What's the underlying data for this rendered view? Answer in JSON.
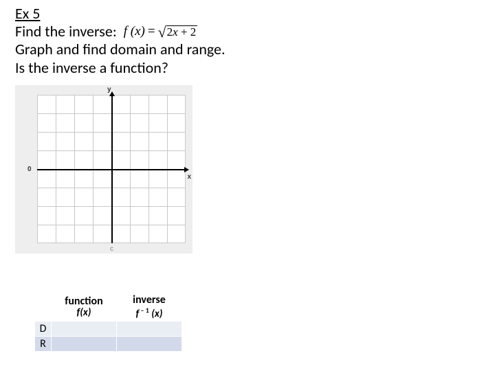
{
  "title": "Ex 5",
  "prompt": {
    "line1_prefix": "Find the inverse:",
    "formula": {
      "lhs": "f (x)",
      "eq": "=",
      "under_sqrt": "2x + 2"
    },
    "line2": "Graph and find domain and range.",
    "line3": "Is the inverse a function?"
  },
  "graph": {
    "y_label": "y",
    "x_label": "x",
    "zero_label": "0",
    "footer_char": "c"
  },
  "table": {
    "headers": {
      "col1_top": "function",
      "col1_sub": "f(x)",
      "col2_top": "inverse",
      "col2_sub_prefix": "f",
      "col2_sub_sup": " – 1",
      "col2_sub_suffix": " (x)"
    },
    "rows": [
      {
        "label": "D",
        "c1": "",
        "c2": ""
      },
      {
        "label": "R",
        "c1": "",
        "c2": ""
      }
    ]
  },
  "chart_data": {
    "type": "line",
    "title": "",
    "xlabel": "x",
    "ylabel": "y",
    "xlim": [
      -4,
      4
    ],
    "ylim": [
      -4,
      4
    ],
    "grid": true,
    "series": []
  }
}
